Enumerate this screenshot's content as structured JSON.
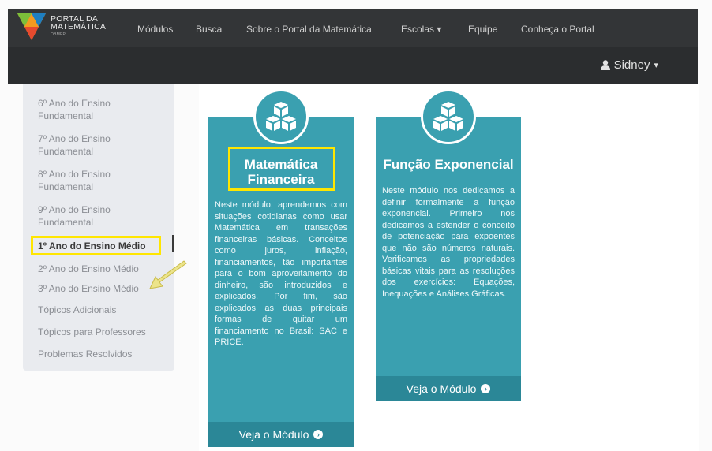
{
  "brand": {
    "line1": "Portal da",
    "line2": "Matemática",
    "sub": "OBMEP",
    "colors": {
      "orange": "#f39a1f",
      "green": "#7cbf3a",
      "blue": "#1e7fc1"
    }
  },
  "nav": {
    "items": [
      "Módulos",
      "Busca",
      "Sobre o Portal da Matemática",
      "Escolas ▾",
      "Equipe",
      "Conheça o Portal"
    ],
    "user": "Sidney",
    "user_caret": "▾",
    "user_icon": "user-icon"
  },
  "sidebar": {
    "items": [
      "6º Ano do Ensino Fundamental",
      "7º Ano do Ensino Fundamental",
      "8º Ano do Ensino Fundamental",
      "9º Ano do Ensino Fundamental",
      "1º Ano do Ensino Médio",
      "2º Ano do Ensino Médio",
      "3º Ano do Ensino Médio",
      "Tópicos Adicionais",
      "Tópicos para Professores",
      "Problemas Resolvidos"
    ],
    "active_index": 4
  },
  "cards": [
    {
      "title_line1": "Matemática",
      "title_line2": "Financeira",
      "description": "Neste módulo, aprendemos com situações cotidianas como usar Matemática em transações financeiras básicas. Conceitos como juros, inflação, financiamentos, tão importantes para o bom aproveitamento do dinheiro, são introduzidos e explicados. Por fim, são explicados as duas principais formas de quitar um financiamento no Brasil: SAC e PRICE.",
      "button": "Veja o Módulo",
      "icon": "cubes-icon"
    },
    {
      "title_line1": "Função Exponencial",
      "title_line2": "",
      "description": "Neste módulo nos dedicamos a definir formalmente a função exponencial. Primeiro nos dedicamos a estender o conceito de potenciação para expoentes que não são números naturais. Verificamos as propriedades básicas vitais para as resoluções dos exercícios: Equações, Inequações e Análises Gráficas.",
      "button": "Veja o Módulo",
      "icon": "cubes-icon"
    }
  ],
  "colors": {
    "card": "#3aa0b0",
    "card_button": "#2b8797",
    "navbar": "#333537",
    "highlight": "#ffe600"
  }
}
